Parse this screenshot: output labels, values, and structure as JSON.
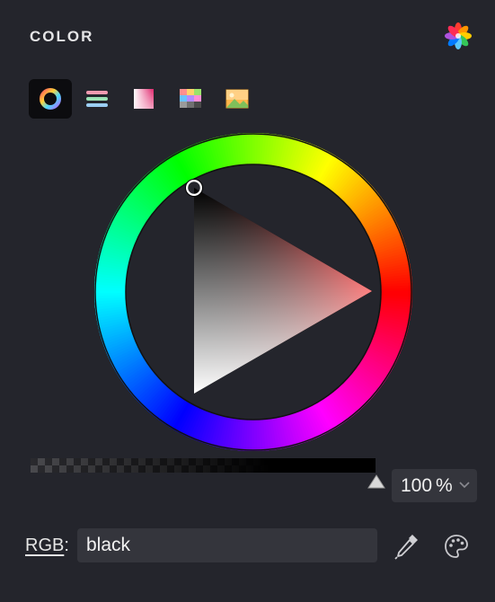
{
  "header": {
    "title": "COLOR"
  },
  "icons": {
    "flower": "multicolor-flower-icon",
    "modes": [
      "color-wheel-icon",
      "color-sliders-icon",
      "color-gradient-icon",
      "color-swatches-icon",
      "image-picker-icon"
    ],
    "eyedropper": "eyedropper-icon",
    "palette": "palette-icon"
  },
  "picker": {
    "hue": 0,
    "selected_color": "#000000"
  },
  "opacity": {
    "value": "100",
    "unit": "%",
    "level": 1.0
  },
  "format": {
    "label_prefix": "RGB",
    "label_suffix": ":"
  },
  "color_field": {
    "value": "black"
  }
}
